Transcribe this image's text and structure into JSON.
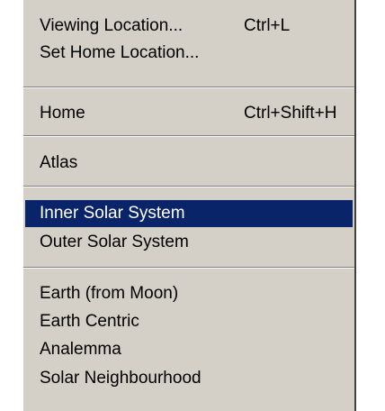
{
  "menu": {
    "groups": [
      {
        "items": [
          {
            "label": "Viewing Location...",
            "shortcut": "Ctrl+L"
          },
          {
            "label": "Set Home Location...",
            "shortcut": ""
          }
        ]
      },
      {
        "items": [
          {
            "label": "Home",
            "shortcut": "Ctrl+Shift+H"
          }
        ]
      },
      {
        "items": [
          {
            "label": "Atlas",
            "shortcut": ""
          }
        ]
      },
      {
        "items": [
          {
            "label": "Inner Solar System",
            "shortcut": "",
            "selected": true
          },
          {
            "label": "Outer Solar System",
            "shortcut": ""
          }
        ]
      },
      {
        "items": [
          {
            "label": "Earth (from Moon)",
            "shortcut": ""
          },
          {
            "label": "Earth Centric",
            "shortcut": ""
          },
          {
            "label": "Analemma",
            "shortcut": ""
          },
          {
            "label": "Solar Neighbourhood",
            "shortcut": ""
          }
        ]
      }
    ]
  },
  "colors": {
    "menu_background": "#d4d0c8",
    "highlight_background": "#0a246a",
    "highlight_text": "#ffffff",
    "text": "#000000"
  }
}
